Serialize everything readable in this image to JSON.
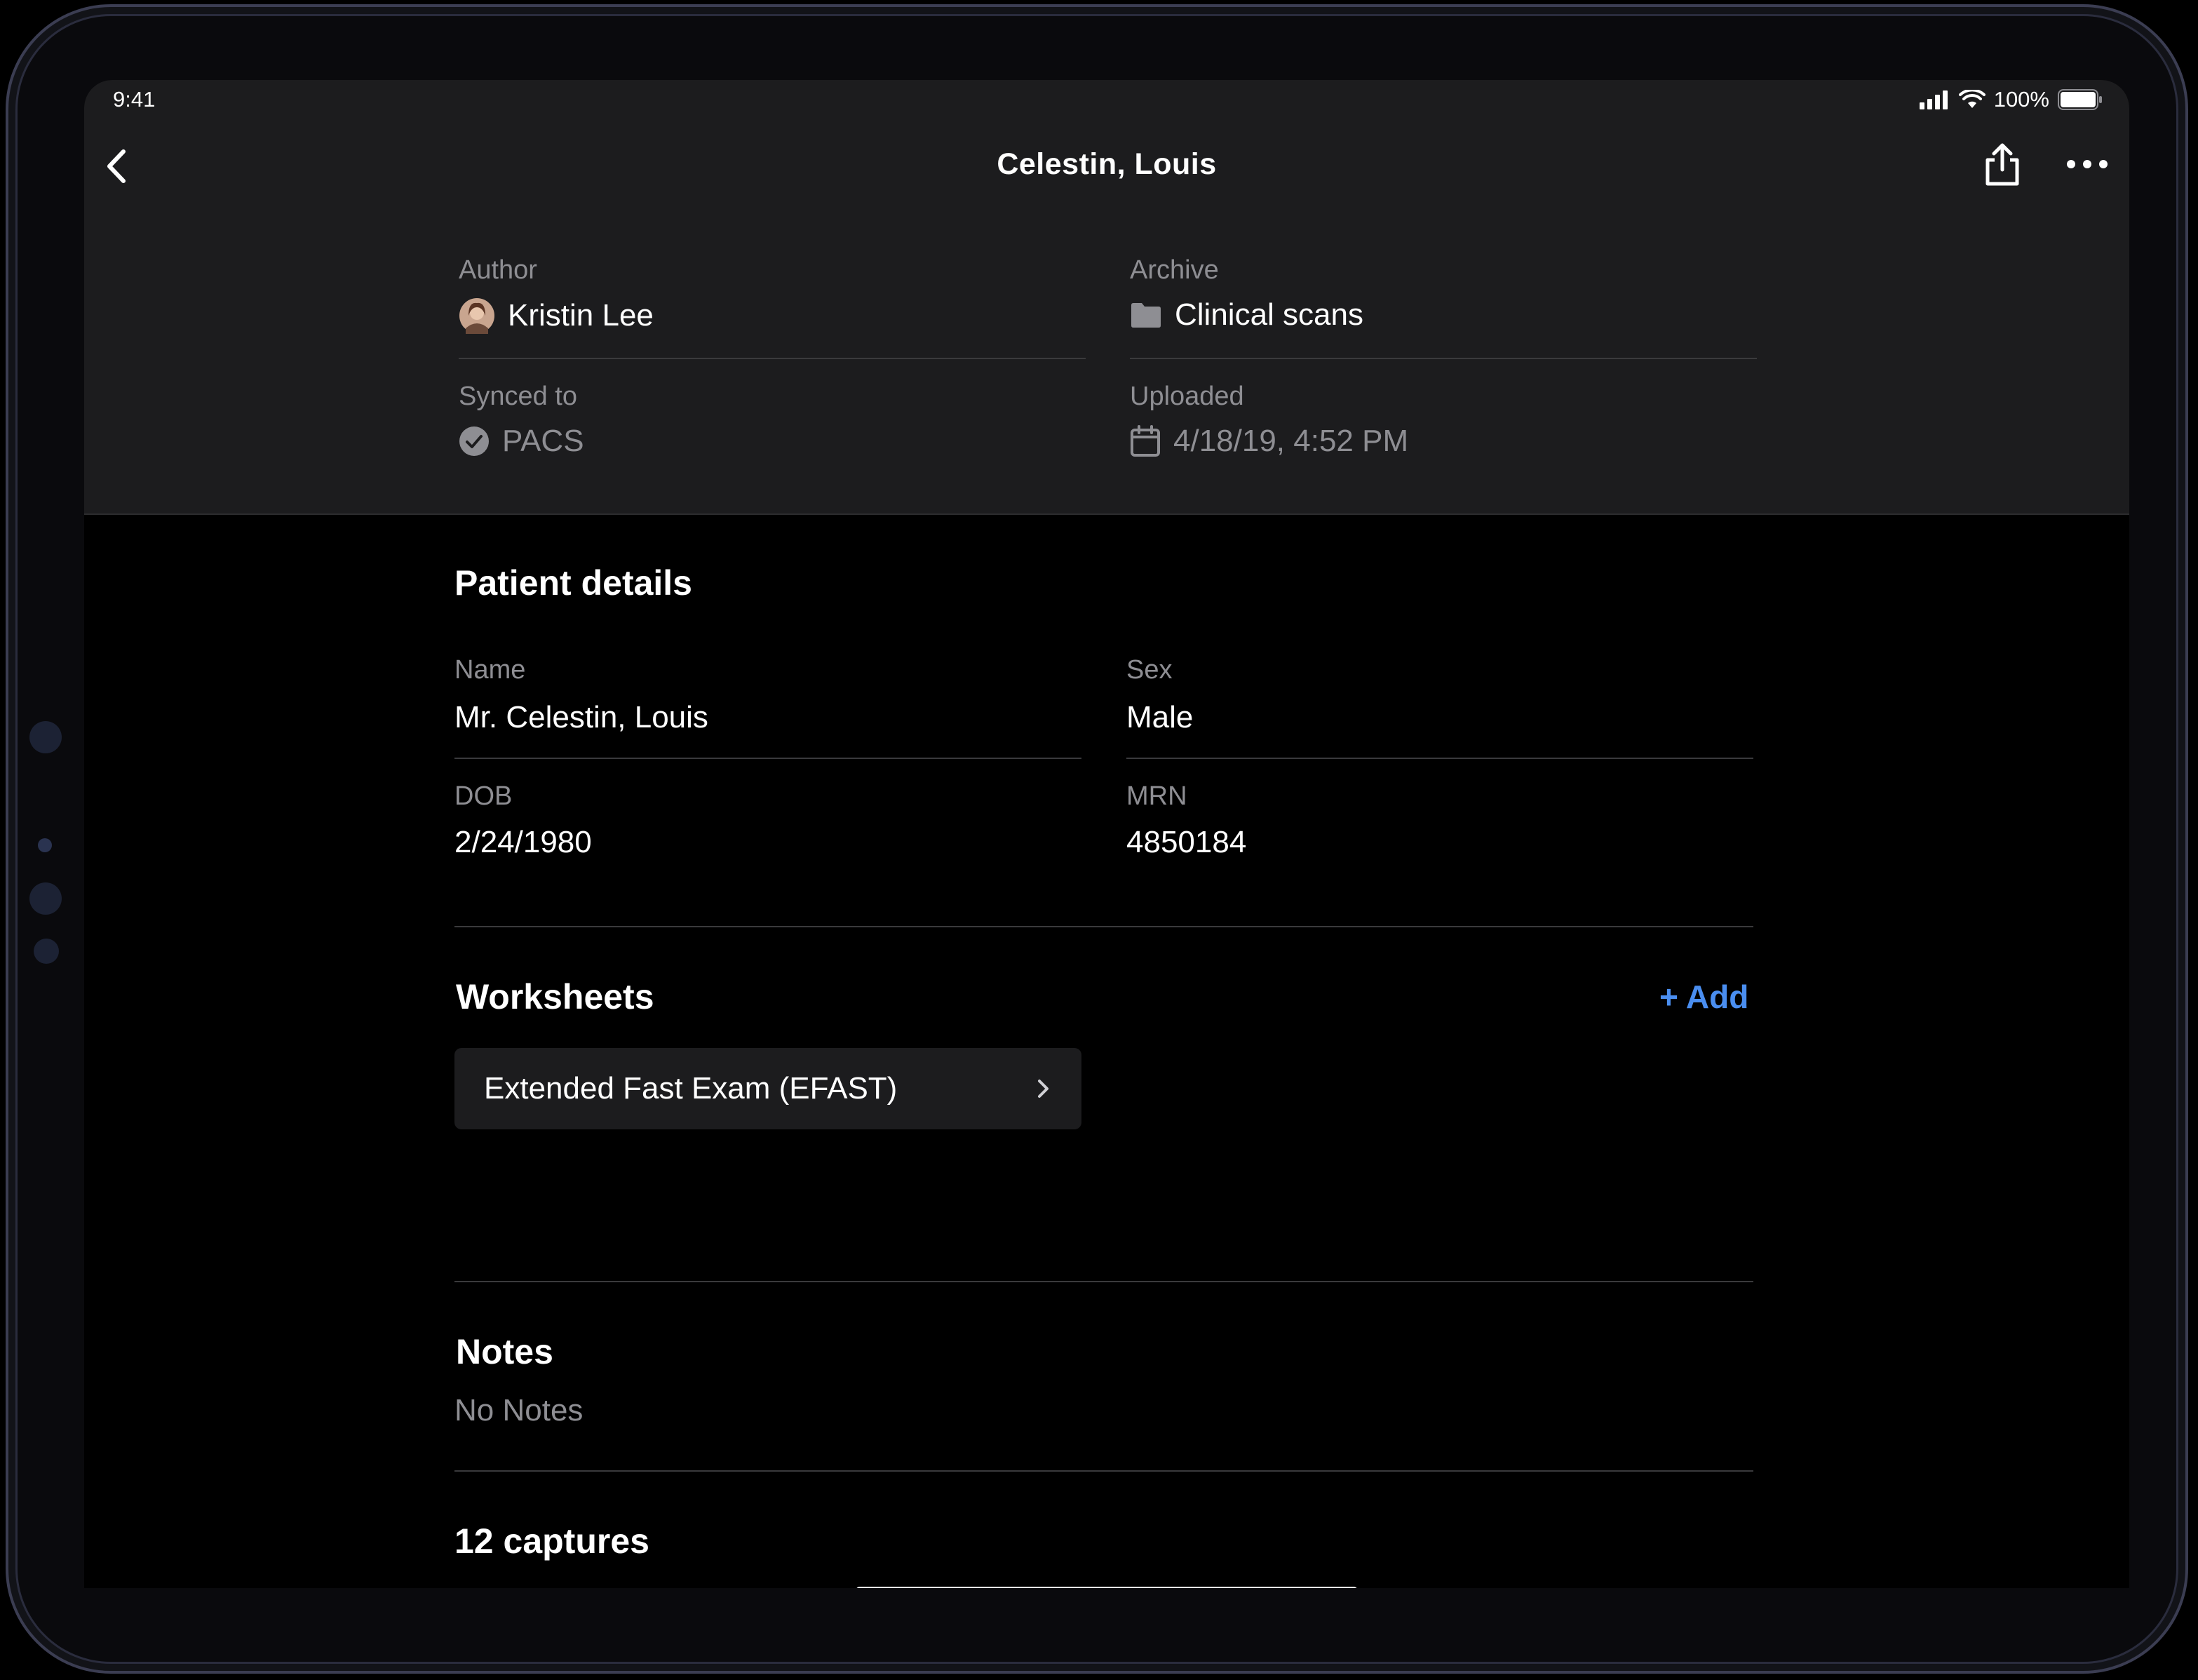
{
  "status_bar": {
    "time": "9:41",
    "battery": "100%"
  },
  "nav": {
    "title": "Celestin, Louis"
  },
  "meta": {
    "author_label": "Author",
    "author_value": "Kristin Lee",
    "archive_label": "Archive",
    "archive_value": "Clinical scans",
    "synced_label": "Synced to",
    "synced_value": "PACS",
    "uploaded_label": "Uploaded",
    "uploaded_value": "4/18/19, 4:52 PM"
  },
  "patient": {
    "title": "Patient details",
    "name_label": "Name",
    "name_value": "Mr. Celestin, Louis",
    "sex_label": "Sex",
    "sex_value": "Male",
    "dob_label": "DOB",
    "dob_value": "2/24/1980",
    "mrn_label": "MRN",
    "mrn_value": "4850184"
  },
  "worksheets": {
    "title": "Worksheets",
    "add_label": "+ Add",
    "items": [
      {
        "label": "Extended Fast Exam (EFAST)"
      }
    ]
  },
  "notes": {
    "title": "Notes",
    "empty_text": "No Notes"
  },
  "captures": {
    "title": "12 captures"
  },
  "colors": {
    "accent": "#4a8ef0",
    "panel": "#1c1c1e",
    "background": "#000000"
  }
}
